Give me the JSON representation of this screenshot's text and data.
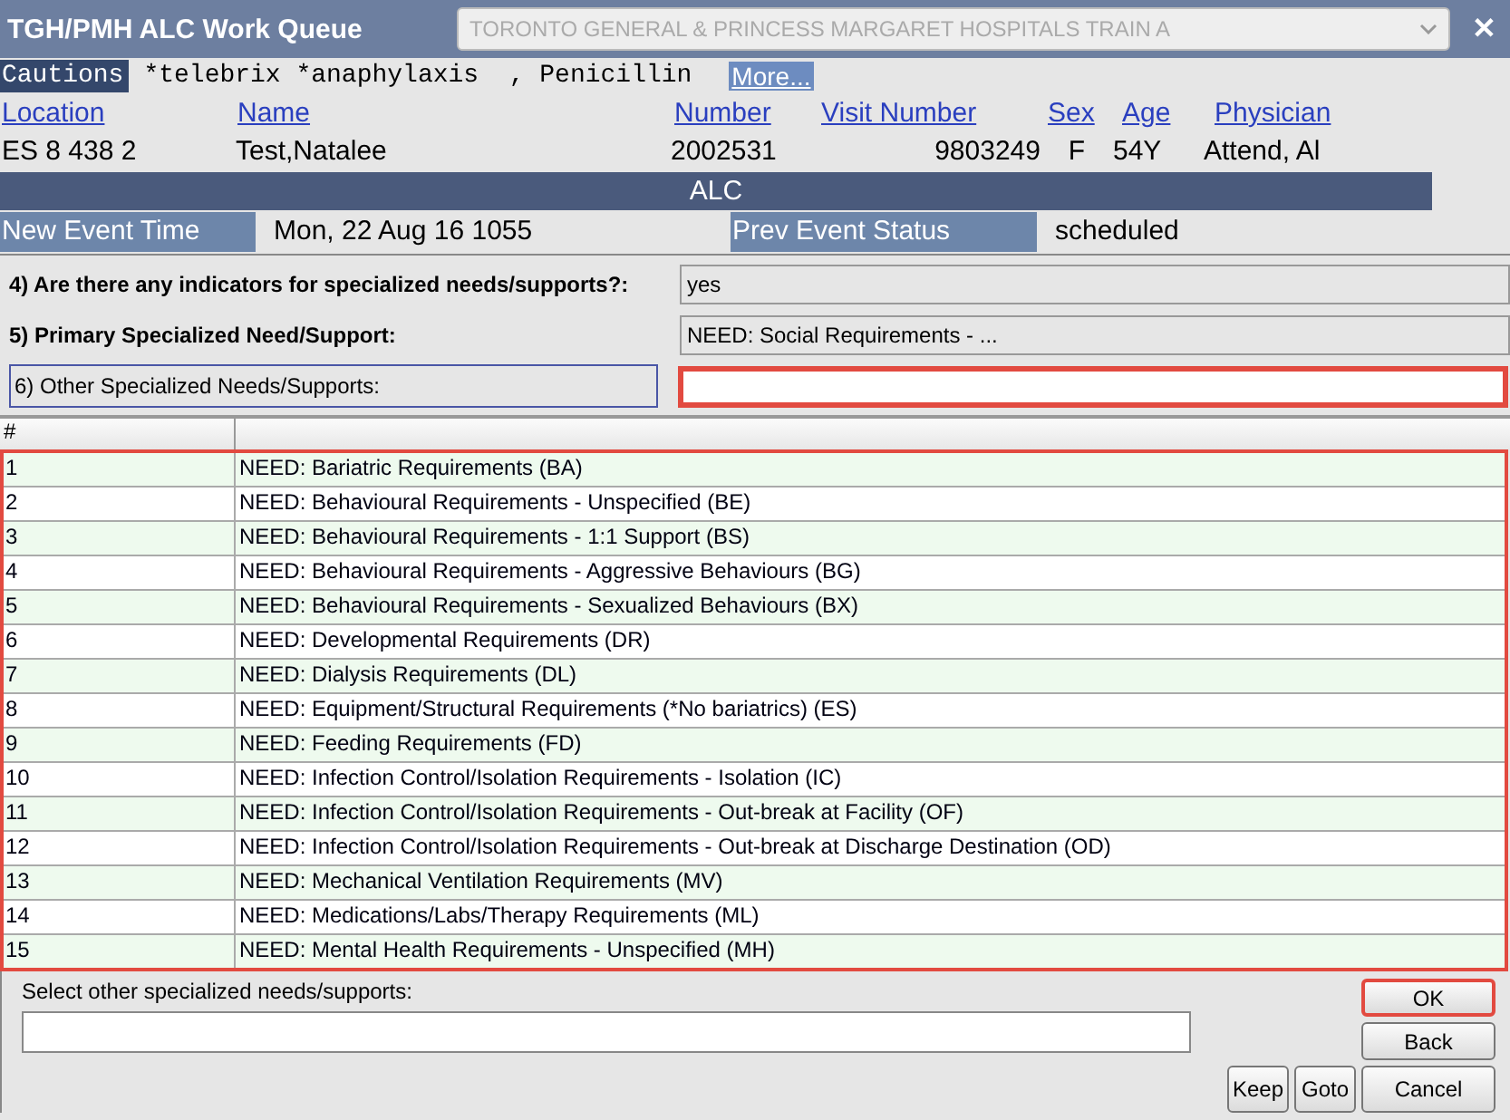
{
  "window": {
    "title": "TGH/PMH ALC Work Queue",
    "facility": "TORONTO GENERAL & PRINCESS MARGARET HOSPITALS TRAIN A",
    "close": "✕"
  },
  "cautions": {
    "label": "Cautions",
    "text": "*telebrix *anaphylaxis  , Penicillin",
    "more": "More..."
  },
  "patient": {
    "columns": [
      {
        "label": "Location",
        "value": "ES 8 438 2"
      },
      {
        "label": "Name",
        "value": "Test,Natalee"
      },
      {
        "label": "Number",
        "value": "2002531"
      },
      {
        "label": "Visit Number",
        "value": "9803249"
      },
      {
        "label": "Sex",
        "value": "F"
      },
      {
        "label": "Age",
        "value": "54Y"
      },
      {
        "label": "Physician",
        "value": "Attend, Al"
      }
    ]
  },
  "section": "ALC",
  "event": {
    "new_label": "New Event Time",
    "new_value": "Mon, 22 Aug 16  1055",
    "prev_label": "Prev Event Status",
    "prev_value": "scheduled"
  },
  "questions": [
    {
      "label": "4)  Are there any indicators for specialized needs/supports?:",
      "value": "yes",
      "invalid": false
    },
    {
      "label": "5)  Primary Specialized Need/Support:",
      "value": "NEED: Social Requirements - ...",
      "invalid": false
    },
    {
      "label": "6)  Other Specialized Needs/Supports:",
      "invalid": true
    }
  ],
  "table": {
    "columns": [
      "#"
    ],
    "invalid": true,
    "rows": [
      {
        "num": "1",
        "text": "NEED: Bariatric Requirements (BA)"
      },
      {
        "num": "2",
        "text": "NEED: Behavioural Requirements - Unspecified (BE)"
      },
      {
        "num": "3",
        "text": "NEED: Behavioural Requirements - 1:1 Support (BS)"
      },
      {
        "num": "4",
        "text": "NEED: Behavioural Requirements - Aggressive Behaviours (BG)"
      },
      {
        "num": "5",
        "text": "NEED: Behavioural Requirements - Sexualized Behaviours (BX)"
      },
      {
        "num": "6",
        "text": "NEED: Developmental Requirements (DR)"
      },
      {
        "num": "7",
        "text": "NEED: Dialysis Requirements (DL)"
      },
      {
        "num": "8",
        "text": "NEED: Equipment/Structural Requirements (*No bariatrics) (ES)"
      },
      {
        "num": "9",
        "text": "NEED: Feeding Requirements (FD)"
      },
      {
        "num": "10",
        "text": "NEED: Infection Control/Isolation Requirements - Isolation (IC)"
      },
      {
        "num": "11",
        "text": "NEED: Infection Control/Isolation Requirements - Out-break at Facility (OF)"
      },
      {
        "num": "12",
        "text": "NEED: Infection Control/Isolation Requirements - Out-break at Discharge Destination (OD)"
      },
      {
        "num": "13",
        "text": "NEED: Mechanical Ventilation Requirements (MV)"
      },
      {
        "num": "14",
        "text": "NEED: Medications/Labs/Therapy Requirements (ML)"
      },
      {
        "num": "15",
        "text": "NEED: Mental Health Requirements - Unspecified (MH)"
      }
    ]
  },
  "select": {
    "label": "Select other specialized needs/supports:"
  },
  "buttons": [
    {
      "label": "OK",
      "focused": true
    },
    {
      "label": "Back",
      "focused": false
    },
    {
      "label": "Keep",
      "focused": false
    },
    {
      "label": "Goto",
      "focused": false
    },
    {
      "label": "Cancel",
      "focused": false
    }
  ]
}
